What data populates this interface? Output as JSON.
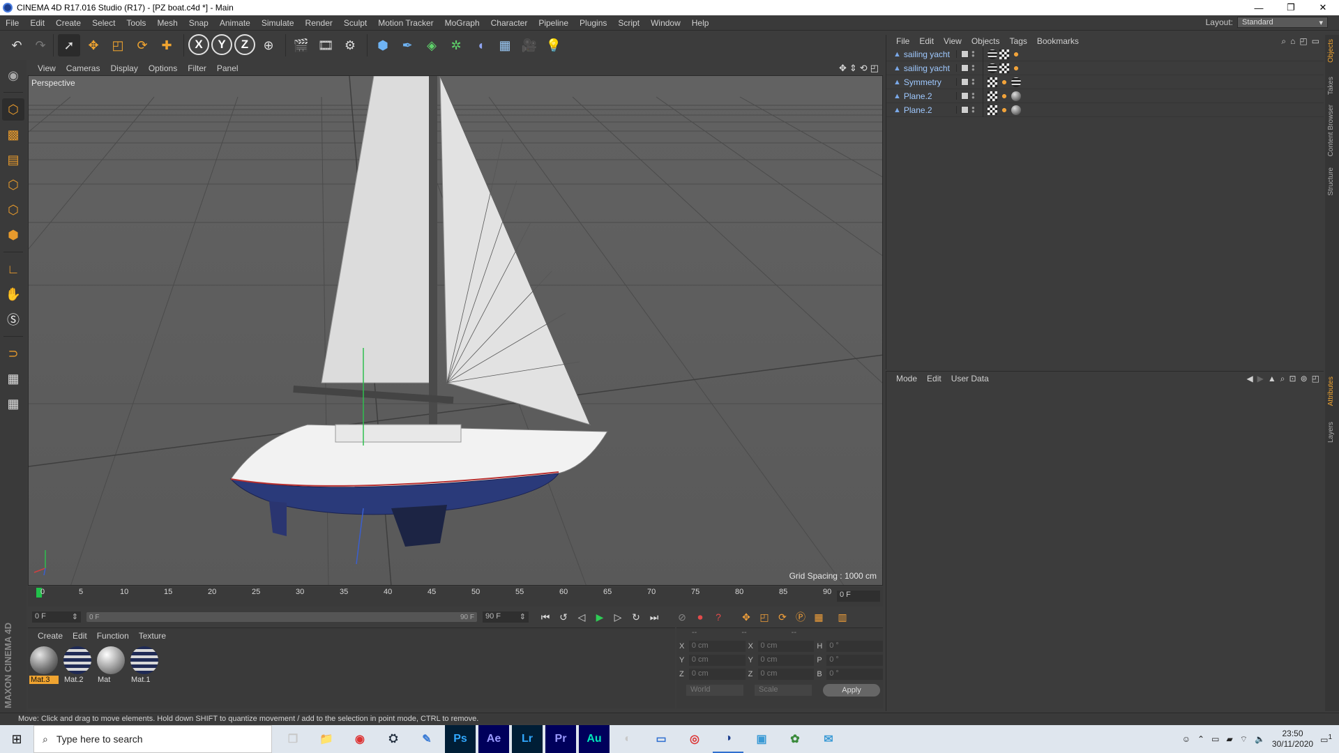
{
  "window": {
    "title": "CINEMA 4D R17.016 Studio (R17) - [PZ boat.c4d *] - Main",
    "controls": [
      "—",
      "❐",
      "✕"
    ]
  },
  "menubar": {
    "items": [
      "File",
      "Edit",
      "Create",
      "Select",
      "Tools",
      "Mesh",
      "Snap",
      "Animate",
      "Simulate",
      "Render",
      "Sculpt",
      "Motion Tracker",
      "MoGraph",
      "Character",
      "Pipeline",
      "Plugins",
      "Script",
      "Window",
      "Help"
    ],
    "layout_label": "Layout:",
    "layout_value": "Standard"
  },
  "viewport": {
    "menu": [
      "View",
      "Cameras",
      "Display",
      "Options",
      "Filter",
      "Panel"
    ],
    "camera_label": "Perspective",
    "grid_spacing": "Grid Spacing : 1000 cm"
  },
  "timeline": {
    "ticks": [
      "0",
      "5",
      "10",
      "15",
      "20",
      "25",
      "30",
      "35",
      "40",
      "45",
      "50",
      "55",
      "60",
      "65",
      "70",
      "75",
      "80",
      "85",
      "90"
    ],
    "current_frame_right": "0 F",
    "start_frame": "0 F",
    "range_start": "0 F",
    "range_end": "90 F",
    "end_frame": "90 F"
  },
  "materials": {
    "menu": [
      "Create",
      "Edit",
      "Function",
      "Texture"
    ],
    "items": [
      {
        "name": "Mat.3",
        "style": "plain",
        "active": true
      },
      {
        "name": "Mat.2",
        "style": "striped",
        "active": false
      },
      {
        "name": "Mat",
        "style": "plain",
        "active": false
      },
      {
        "name": "Mat.1",
        "style": "striped",
        "active": false
      }
    ]
  },
  "coordinates": {
    "headers": [
      "--",
      "--",
      "--"
    ],
    "rows": [
      {
        "a1": "X",
        "v1": "0 cm",
        "a2": "X",
        "v2": "0 cm",
        "a3": "H",
        "v3": "0 °"
      },
      {
        "a1": "Y",
        "v1": "0 cm",
        "a2": "Y",
        "v2": "0 cm",
        "a3": "P",
        "v3": "0 °"
      },
      {
        "a1": "Z",
        "v1": "0 cm",
        "a2": "Z",
        "v2": "0 cm",
        "a3": "B",
        "v3": "0 °"
      }
    ],
    "world": "World",
    "scale": "Scale",
    "apply": "Apply"
  },
  "status": {
    "text": "Move: Click and drag to move elements. Hold down SHIFT to quantize movement / add to the selection in point mode, CTRL to remove."
  },
  "objects": {
    "menu": [
      "File",
      "Edit",
      "View",
      "Objects",
      "Tags",
      "Bookmarks"
    ],
    "items": [
      {
        "name": "sailing yacht",
        "tags": [
          "stripe",
          "checker",
          "phong"
        ]
      },
      {
        "name": "sailing yacht",
        "tags": [
          "stripe",
          "checker",
          "phong"
        ]
      },
      {
        "name": "Symmetry",
        "tags": [
          "checker",
          "phong",
          "stripe"
        ]
      },
      {
        "name": "Plane.2",
        "tags": [
          "checker",
          "phong",
          "sphere"
        ]
      },
      {
        "name": "Plane.2",
        "tags": [
          "checker",
          "phong",
          "sphere"
        ]
      }
    ]
  },
  "attributes": {
    "menu": [
      "Mode",
      "Edit",
      "User Data"
    ]
  },
  "sidetabs": {
    "top": [
      "Objects",
      "Takes",
      "Content Browser",
      "Structure"
    ],
    "bottom": [
      "Attributes",
      "Layers"
    ]
  },
  "maxon_logo": "MAXON CINEMA 4D",
  "taskbar": {
    "search_placeholder": "Type here to search",
    "apps": [
      "❐",
      "📁",
      "◉",
      "⛭",
      "✎",
      "Ps",
      "Ae",
      "Lr",
      "Pr",
      "Au",
      "◐",
      "▭",
      "◎",
      "◑",
      "▣",
      "✿",
      "✉"
    ],
    "time": "23:50",
    "date": "30/11/2020",
    "notification_count": "1"
  },
  "colors": {
    "accent": "#f0a430",
    "playhead": "#21c14a",
    "background": "#3c3c3c",
    "viewport": "#5e5e5e"
  }
}
